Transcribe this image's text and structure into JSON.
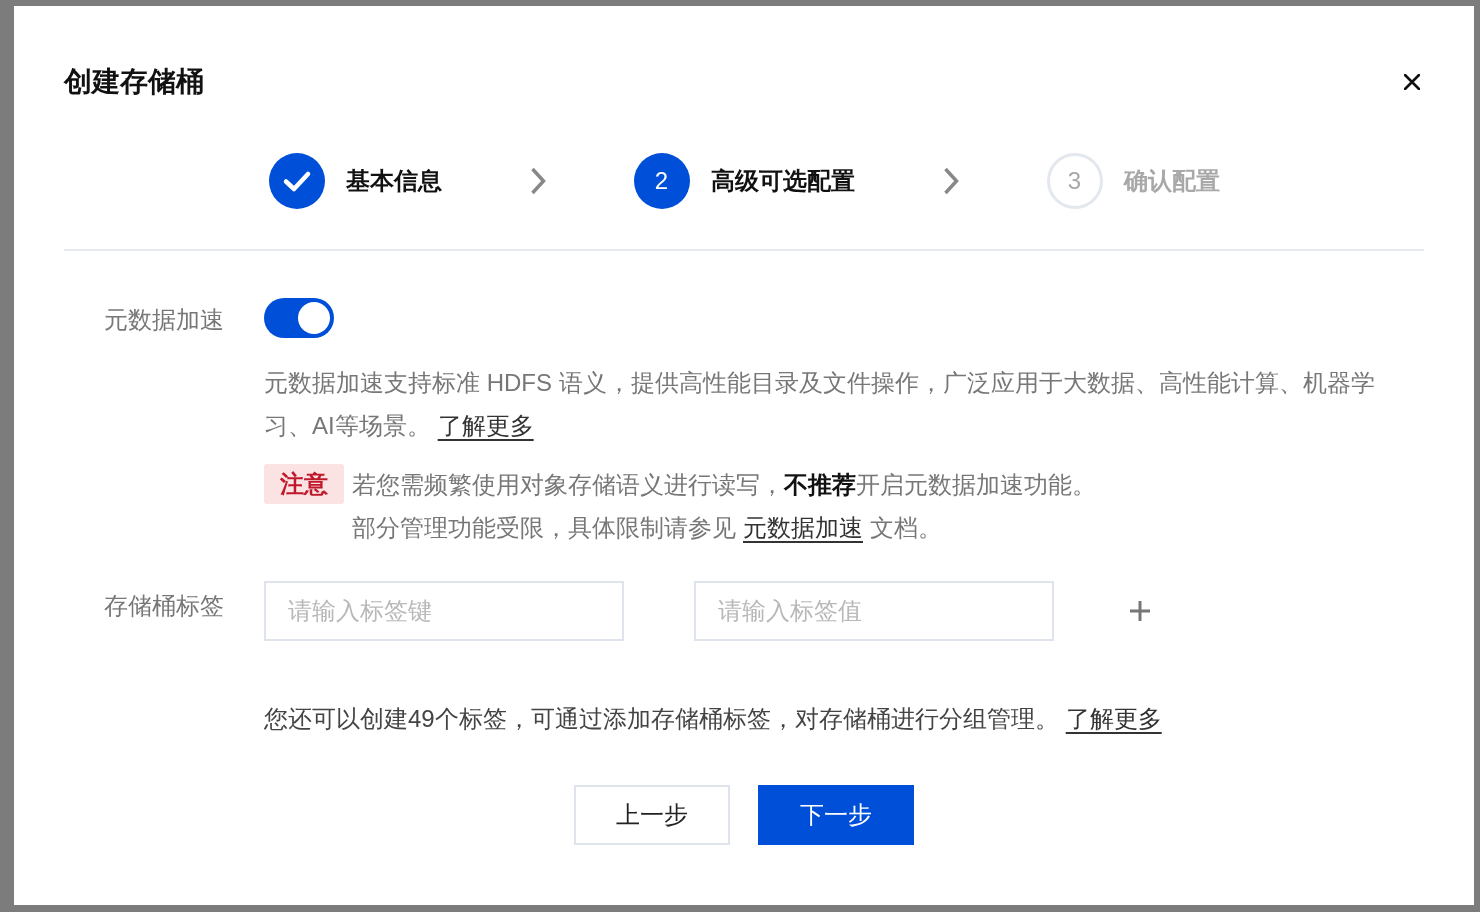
{
  "dialog": {
    "title": "创建存储桶",
    "steps": [
      {
        "label": "基本信息",
        "completed": true,
        "selected": false
      },
      {
        "number": "2",
        "label": "高级可选配置",
        "completed": false,
        "selected": true
      },
      {
        "number": "3",
        "label": "确认配置",
        "completed": false,
        "selected": false
      }
    ],
    "metadata_acceleration": {
      "label": "元数据加速",
      "on": true,
      "description": {
        "text": "元数据加速支持标准 HDFS 语义，提供高性能目录及文件操作，广泛应用于大数据、高性能计算、机器学习、AI等场景。",
        "link": "了解更多"
      },
      "notice": {
        "tag": "注意",
        "lines": [
          {
            "text": "若您需频繁使用对象存储语义进行读写，**不推荐**开启元数据加速功能。"
          },
          {
            "text": "部分管理功能受限，具体限制请参见",
            "link": "元数据加速",
            "after": "文档。"
          }
        ]
      }
    },
    "bucket_tags": {
      "label": "存储桶标签",
      "key_field": {
        "placeholder": "请输入标签键"
      },
      "value_field": {
        "placeholder": "请输入标签值"
      },
      "hint": {
        "text": "您还可以创建49个标签，可通过添加存储桶标签，对存储桶进行分组管理。",
        "link": "了解更多"
      }
    },
    "buttons": [
      {
        "label": "上一步",
        "kind": "secondary"
      },
      {
        "label": "下一步",
        "kind": "primary"
      }
    ]
  }
}
